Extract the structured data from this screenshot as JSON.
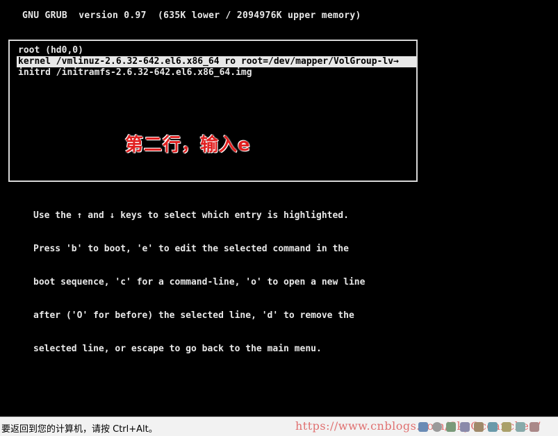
{
  "header": {
    "text": "GNU GRUB  version 0.97  (635K lower / 2094976K upper memory)"
  },
  "menu": {
    "entries": [
      {
        "text": "root (hd0,0)",
        "selected": false
      },
      {
        "text": "kernel /vmlinuz-2.6.32-642.el6.x86_64 ro root=/dev/mapper/VolGroup-lv→",
        "selected": true
      },
      {
        "text": "initrd /initramfs-2.6.32-642.el6.x86_64.img",
        "selected": false
      }
    ]
  },
  "annotation": {
    "text": "第二行，输入e",
    "color": "#e02020"
  },
  "help": {
    "lines": [
      "Use the ↑ and ↓ keys to select which entry is highlighted.",
      "Press 'b' to boot, 'e' to edit the selected command in the",
      "boot sequence, 'c' for a command-line, 'o' to open a new line",
      "after ('O' for before) the selected line, 'd' to remove the",
      "selected line, or escape to go back to the main menu."
    ]
  },
  "statusbar": {
    "text": "要返回到您的计算机，请按 Ctrl+Alt。",
    "watermark": "https://www.cnblogs.com/SkyOceanchen/"
  },
  "tray": {
    "icons": [
      "network-icon",
      "disk-icon",
      "usb-icon",
      "printer-icon",
      "sound-icon",
      "display-icon",
      "cd-icon",
      "folder-icon",
      "message-icon"
    ]
  }
}
